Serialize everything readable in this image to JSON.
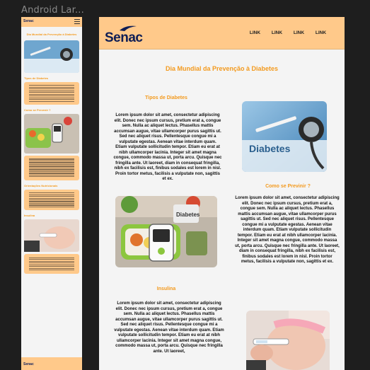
{
  "canvas": {
    "label": "Android Lar..."
  },
  "mobile": {
    "logo": "Senac",
    "title": "Dia Mundial  da  Prevenção à Diabetes",
    "sections": [
      "Tipos de Diabetes",
      "Como se Prevenir ?",
      "Orientações Nutricionais",
      "Insulina"
    ]
  },
  "desktop": {
    "logo": "Senac",
    "nav": [
      "LINK",
      "LINK",
      "LINK",
      "LINK"
    ],
    "title": "Dia Mundial  da  Prevenção à Diabetes",
    "section1": {
      "heading": "Tipos de Diabetes",
      "body": "Lorem ipsum dolor sit amet, consectetur adipiscing elit. Donec nec ipsum cursus, pretium erat a, congue sem. Nulla ac aliquet lectus. Phasellus mattis accumsan augue, vitae ullamcorper purus sagittis ut. Sed nec aliquet risus. Pellentesque congue mi a vulputate egestas. Aenean vitae interdum quam. Etiam vulputate sollicitudin tempor. Etiam eu erat at nibh ullamcorper lacinia. Integer sit amet magna congue, commodo massa ut, porta arcu. Quisque nec fringilla ante. Ut laoreet, diam in consequat fringilla, nibh ex facilisis est, finibus sodales est lorem in nisl. Proin tortor metus, facilisis a vulputate non, sagittis et ex."
    },
    "section2": {
      "heading": "Como se Previnir ?",
      "body": "Lorem ipsum dolor sit amet, consectetur adipiscing elit. Donec nec ipsum cursus, pretium erat a, congue sem. Nulla ac aliquet lectus. Phasellus mattis accumsan augue, vitae ullamcorper purus sagittis ut. Sed nec aliquet risus. Pellentesque congue mi a vulputate egestas. Aenean vitae interdum quam. Etiam vulputate sollicitudin tempor. Etiam eu erat at nibh ullamcorper lacinia. Integer sit amet magna congue, commodo massa ut, porta arcu. Quisque nec fringilla ante. Ut laoreet, diam in consequat fringilla, nibh ex facilisis est, finibus sodales est lorem in nisl. Proin tortor metus, facilisis a vulputate non, sagittis et ex."
    },
    "section3": {
      "heading": "Insulina",
      "body": "Lorem ipsum dolor sit amet, consectetur adipiscing elit. Donec nec ipsum cursus, pretium erat a, congue sem. Nulla ac aliquet lectus. Phasellus mattis accumsan augue, vitae ullamcorper purus sagittis ut. Sed nec aliquet risus. Pellentesque congue mi a vulputate egestas. Aenean vitae interdum quam. Etiam vulputate sollicitudin tempor. Etiam eu erat at nibh ullamcorper lacinia. Integer sit amet magna congue, commodo massa ut, porta arcu. Quisque nec fringilla ante. Ut laoreet,"
    },
    "photo_label": "Diabetes"
  },
  "colors": {
    "accent": "#f39a1e",
    "header_bg": "#ffc98a",
    "brand_navy": "#0f1e55"
  }
}
